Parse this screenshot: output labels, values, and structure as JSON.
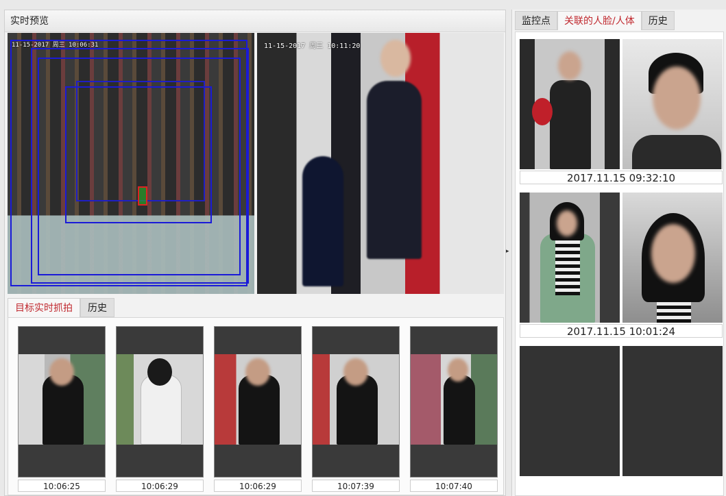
{
  "live_preview": {
    "title": "实时预览",
    "camera1_osd": "11-15-2017 周三 10:06:31",
    "camera2_osd": "11-15-2017 周三 10:11:20"
  },
  "capture_tabs": [
    {
      "label": "目标实时抓拍",
      "active": true
    },
    {
      "label": "历史",
      "active": false
    }
  ],
  "captures": [
    {
      "time": "10:06:25"
    },
    {
      "time": "10:06:29"
    },
    {
      "time": "10:06:29"
    },
    {
      "time": "10:07:39"
    },
    {
      "time": "10:07:40"
    }
  ],
  "right_tabs": [
    {
      "label": "监控点",
      "active": false
    },
    {
      "label": "关联的人脸/人体",
      "active": true
    },
    {
      "label": "历史",
      "active": false
    }
  ],
  "associations": [
    {
      "timestamp": "2017.11.15 09:32:10"
    },
    {
      "timestamp": "2017.11.15 10:01:24"
    }
  ],
  "colors": {
    "active_tab": "#c0292f",
    "bbox": "#1a1ad8"
  }
}
